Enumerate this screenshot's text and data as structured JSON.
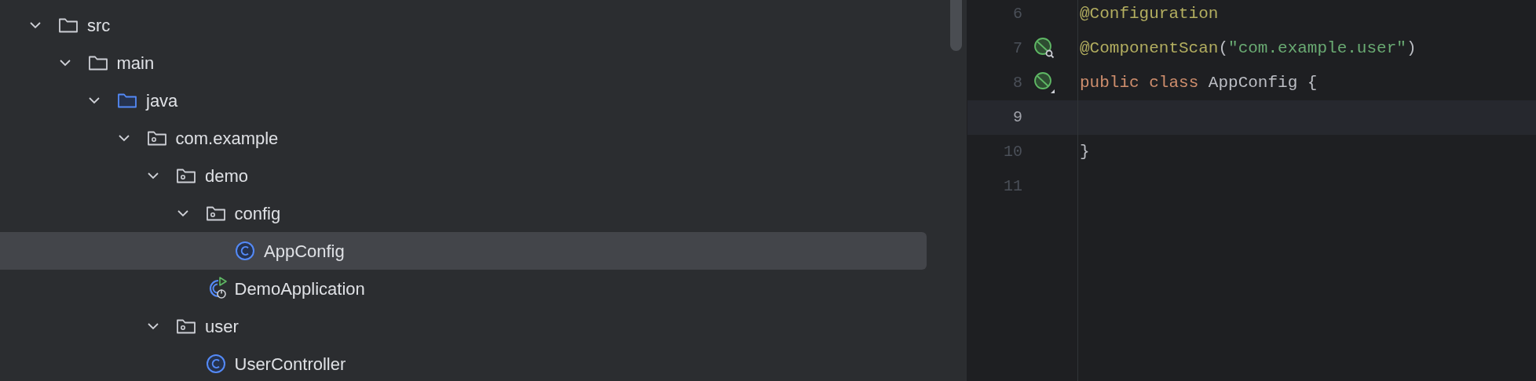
{
  "project_tree": [
    {
      "label": "src",
      "kind": "folder",
      "expanded": true,
      "selected": false,
      "children": [
        {
          "label": "main",
          "kind": "folder",
          "expanded": true,
          "selected": false,
          "children": [
            {
              "label": "java",
              "kind": "source-folder",
              "expanded": true,
              "selected": false,
              "children": [
                {
                  "label": "com.example",
                  "kind": "package",
                  "expanded": true,
                  "selected": false,
                  "children": [
                    {
                      "label": "demo",
                      "kind": "package",
                      "expanded": true,
                      "selected": false,
                      "children": [
                        {
                          "label": "config",
                          "kind": "package",
                          "expanded": true,
                          "selected": false,
                          "children": [
                            {
                              "label": "AppConfig",
                              "kind": "class",
                              "selected": true
                            }
                          ]
                        },
                        {
                          "label": "DemoApplication",
                          "kind": "boot-class",
                          "selected": false
                        }
                      ]
                    },
                    {
                      "label": "user",
                      "kind": "package",
                      "expanded": true,
                      "selected": false,
                      "children": [
                        {
                          "label": "UserController",
                          "kind": "class",
                          "selected": false
                        }
                      ]
                    }
                  ]
                }
              ]
            }
          ]
        }
      ]
    }
  ],
  "editor": {
    "lines": [
      {
        "number": "6",
        "current": false,
        "tokens": [
          {
            "text": "@Configuration",
            "kind": "annotation"
          }
        ]
      },
      {
        "number": "7",
        "current": false,
        "gutter": {
          "kind": "bean-search"
        },
        "tokens": [
          {
            "text": "@ComponentScan",
            "kind": "annotation"
          },
          {
            "text": "(",
            "kind": "plain"
          },
          {
            "text": "\"com.example.user\"",
            "kind": "string"
          },
          {
            "text": ")",
            "kind": "plain"
          }
        ]
      },
      {
        "number": "8",
        "current": false,
        "gutter": {
          "kind": "bean"
        },
        "tokens": [
          {
            "text": "public",
            "kind": "keyword"
          },
          {
            "text": " class",
            "kind": "keyword"
          },
          {
            "text": " AppConfig {",
            "kind": "plain"
          }
        ]
      },
      {
        "number": "9",
        "current": true
      },
      {
        "number": "10",
        "current": false,
        "tokens": [
          {
            "text": "}",
            "kind": "plain"
          }
        ]
      },
      {
        "number": "11",
        "current": false
      }
    ]
  }
}
